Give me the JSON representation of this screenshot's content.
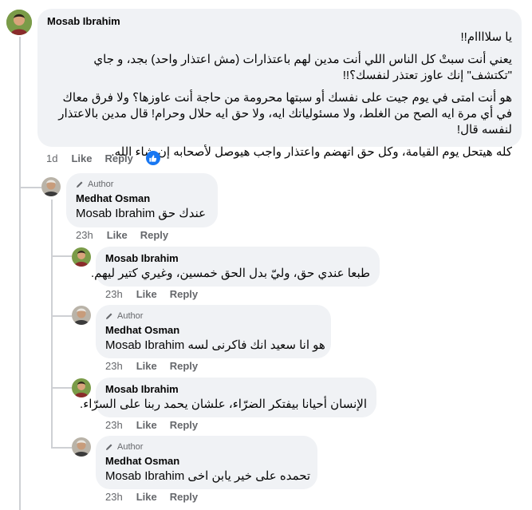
{
  "main_comment": {
    "author": "Mosab Ibrahim",
    "paragraphs": [
      "يا سلاااام!!",
      "يعني أنت سبتْ كل الناس اللي أنت مدين لهم باعتذارات (مش اعتذار واحد) بجد، و جاي \"تكتشف\" إنك عاوز تعتذر لنفسك؟!!",
      "هو أنت امتى في يوم جيت على نفسك أو سبتها محرومة من حاجة أنت عاوزها؟ ولا فرق معاك في أي مرة ايه الصح من الغلط، ولا مسئولياتك ايه، ولا حق ايه حلال وحرام! قال مدين بالاعتذار لنفسه قال!",
      "كله هيتحل يوم القيامة، وكل حق اتهضم واعتذار واجب هيوصل لأصحابه إن شاء الله."
    ],
    "time": "1d",
    "like_label": "Like",
    "reply_label": "Reply"
  },
  "replies": [
    {
      "author": "Medhat Osman",
      "author_badge": "Author",
      "mention": "Mosab Ibrahim",
      "text": "عندك حق",
      "time": "23h",
      "like_label": "Like",
      "reply_label": "Reply"
    },
    {
      "author": "Mosab Ibrahim",
      "text": "طبعا عندي حق، وليّ بدل الحق خمسين، وغيري كتير ليهم.",
      "time": "23h",
      "like_label": "Like",
      "reply_label": "Reply"
    },
    {
      "author": "Medhat Osman",
      "author_badge": "Author",
      "mention": "Mosab Ibrahim",
      "text": "هو انا سعيد انك فاكرنى لسه",
      "time": "23h",
      "like_label": "Like",
      "reply_label": "Reply"
    },
    {
      "author": "Mosab Ibrahim",
      "text": "الإنسان أحيانا بيفتكر الضرّاء، علشان يحمد ربنا على السرّاء.",
      "time": "23h",
      "like_label": "Like",
      "reply_label": "Reply"
    },
    {
      "author": "Medhat Osman",
      "author_badge": "Author",
      "mention": "Mosab Ibrahim",
      "text": "تحمده على خير يابن اخى",
      "time": "23h",
      "like_label": "Like",
      "reply_label": "Reply"
    }
  ],
  "colors": {
    "bubble": "#f0f2f5",
    "meta": "#65676b",
    "like_blue": "#1877f2",
    "thread": "#ced0d4"
  },
  "icons": {
    "author_badge": "pencil-icon",
    "reaction": "thumbs-up-icon"
  }
}
